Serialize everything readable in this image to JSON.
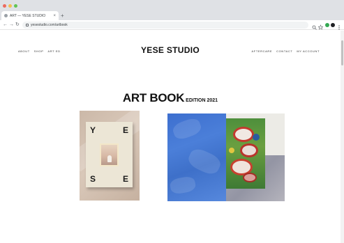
{
  "browser": {
    "tab_title": "ART — YESE STUDIO",
    "tab_close": "×",
    "new_tab": "+",
    "url": "yesestudio.com/artbook",
    "back": "←",
    "forward": "→",
    "reload": "↻",
    "colors": {
      "close": "#ed6a5e",
      "minimize": "#f5bf4f",
      "zoom": "#61c554"
    }
  },
  "site": {
    "brand": "YESE STUDIO",
    "nav_left": [
      "ABOUT",
      "SHOP",
      "ART ED"
    ],
    "nav_right": [
      "AFTERCARE",
      "CONTACT",
      "MY ACCOUNT"
    ]
  },
  "main": {
    "heading": "ART BOOK",
    "heading_suffix": "EDITION 2021"
  },
  "products": [
    {
      "name": "book-cover",
      "cover_letters": [
        "Y",
        "E",
        "S",
        "E"
      ]
    },
    {
      "name": "open-book-spread"
    }
  ]
}
